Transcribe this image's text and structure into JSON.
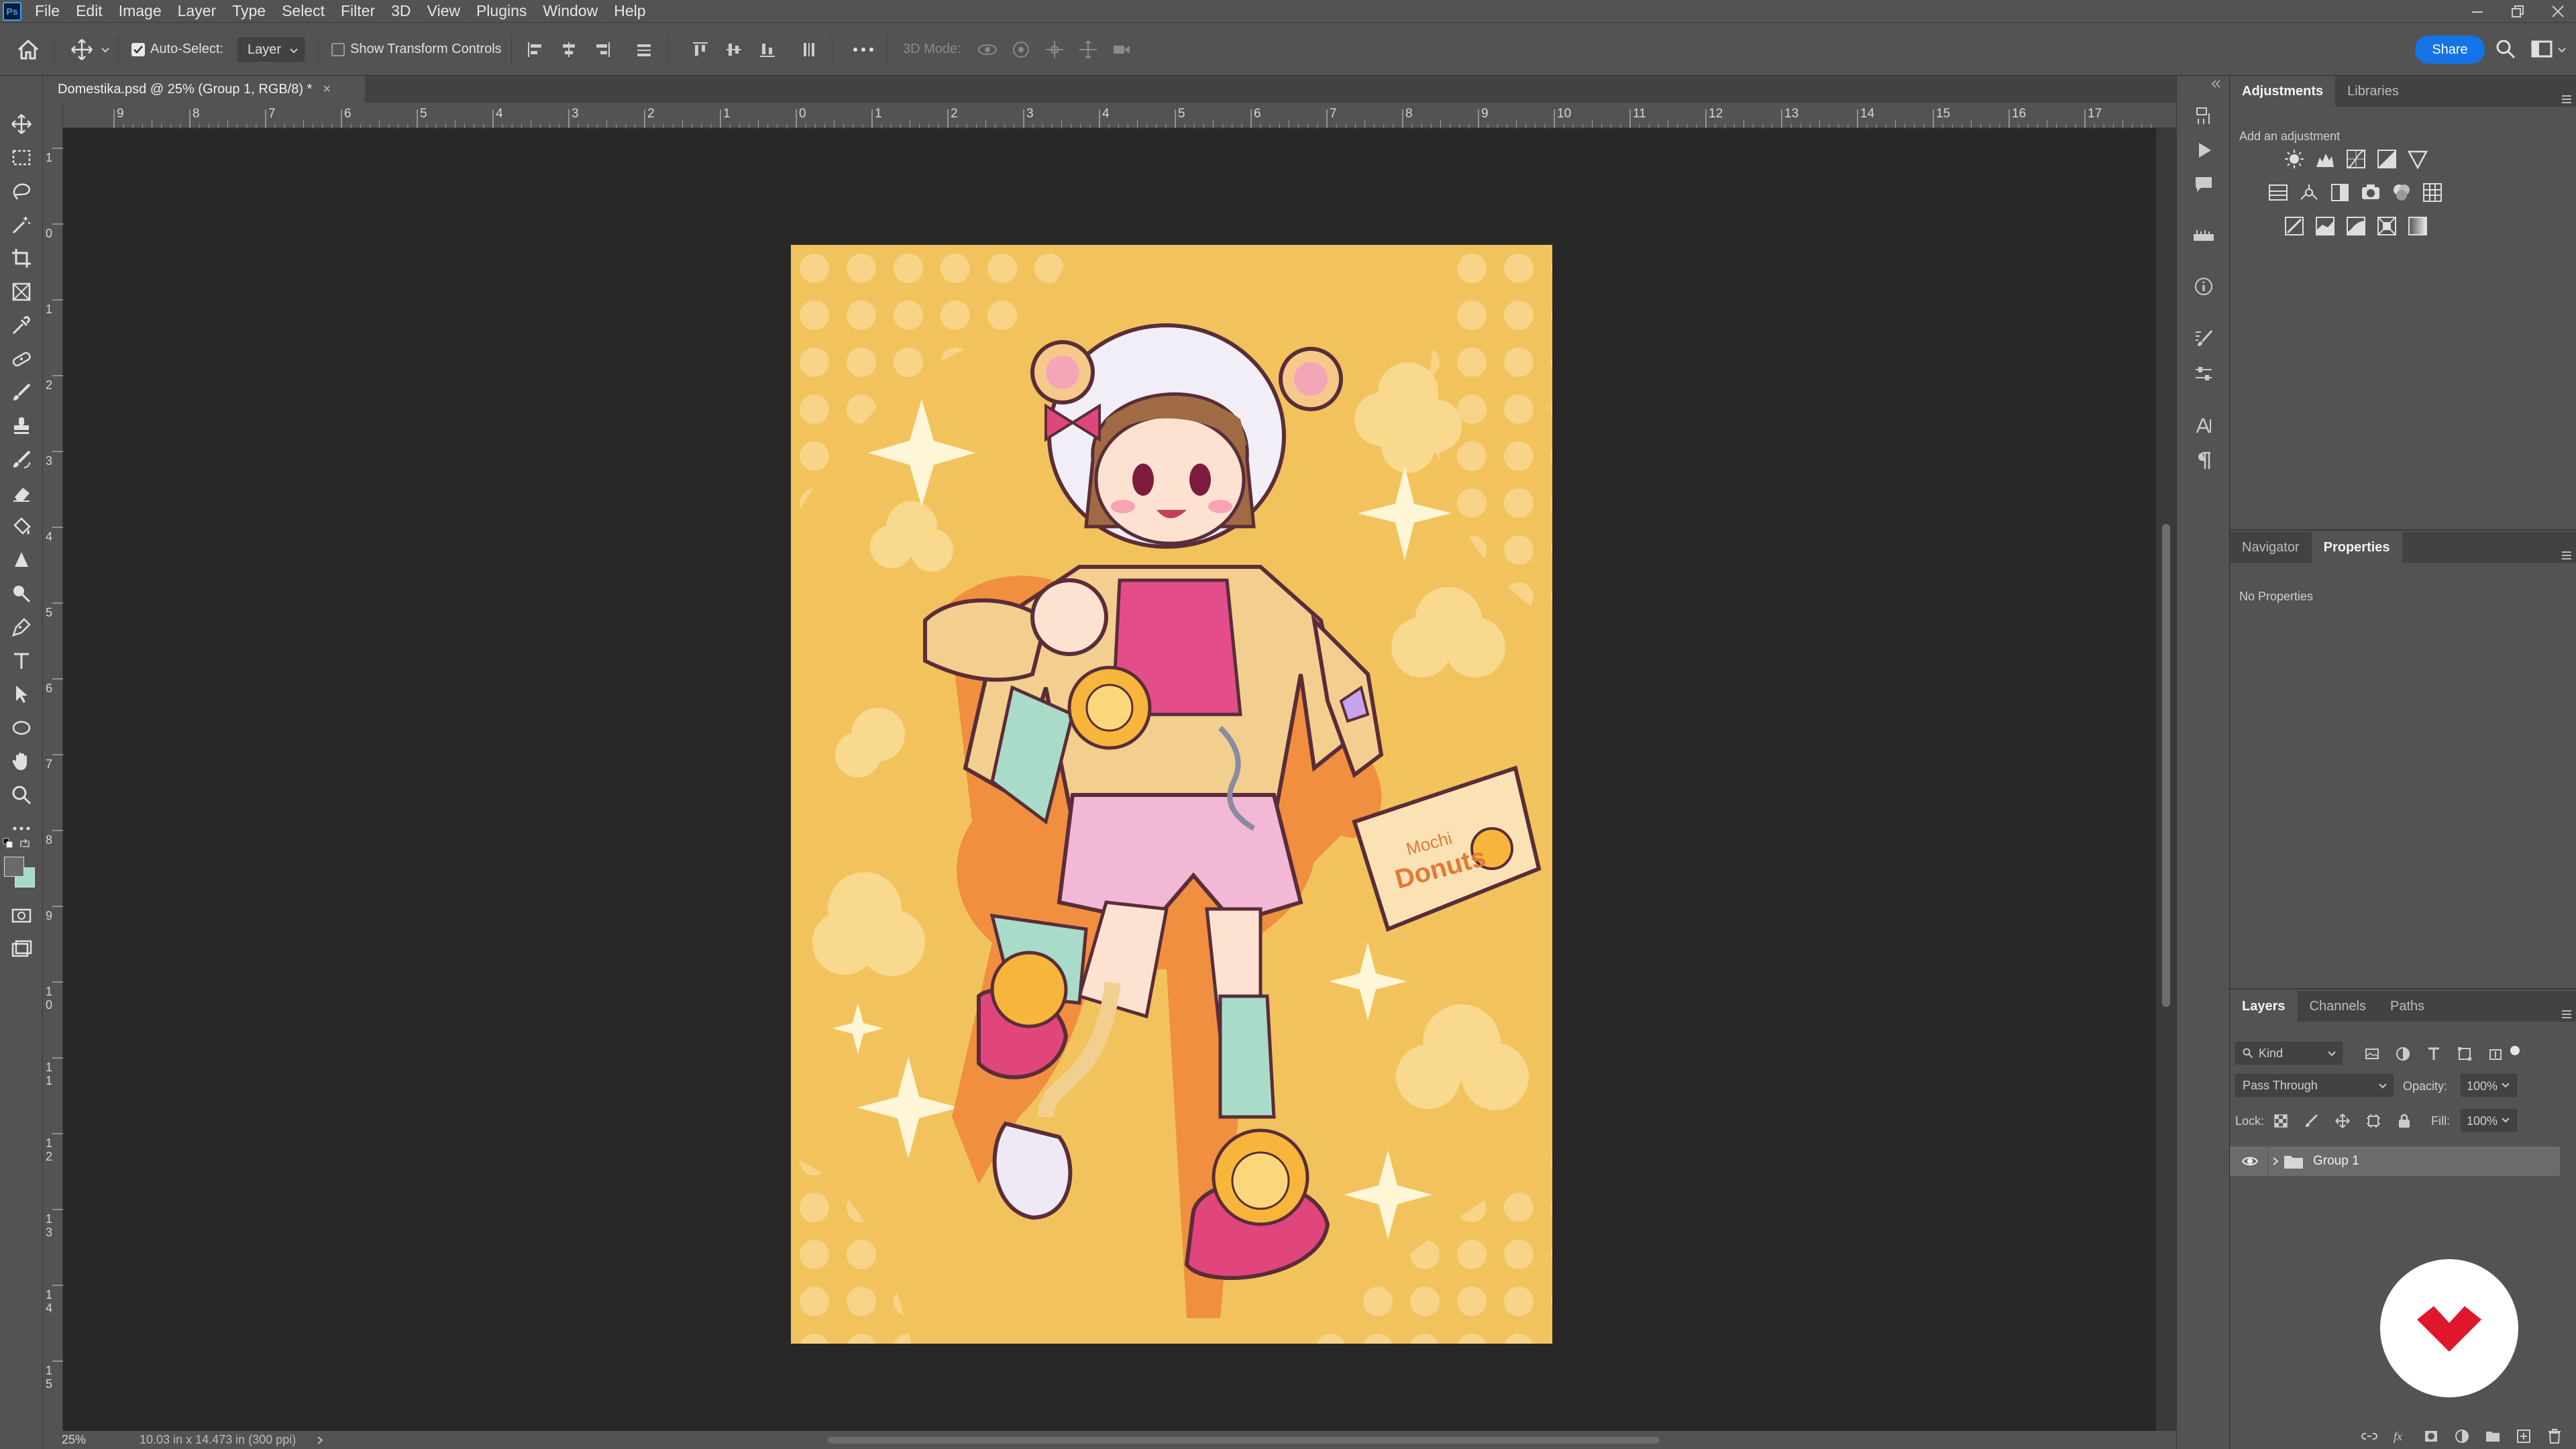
{
  "menu": {
    "app_icon": "Ps",
    "items": [
      "File",
      "Edit",
      "Image",
      "Layer",
      "Type",
      "Select",
      "Filter",
      "3D",
      "View",
      "Plugins",
      "Window",
      "Help"
    ]
  },
  "options_bar": {
    "auto_select_label": "Auto-Select:",
    "auto_select_checked": true,
    "auto_select_target": "Layer",
    "show_transform_label": "Show Transform Controls",
    "show_transform_checked": false,
    "mode_3d_label": "3D Mode:",
    "share_label": "Share"
  },
  "document": {
    "tab_title": "Domestika.psd @ 25% (Group 1, RGB/8) *",
    "close_glyph": "×",
    "zoom": "25%",
    "doc_info": "10.03 in x 14.473 in (300 ppi)"
  },
  "rulers": {
    "horizontal": [
      "9",
      "8",
      "7",
      "6",
      "5",
      "4",
      "3",
      "2",
      "1",
      "0",
      "1",
      "2",
      "3",
      "4",
      "5",
      "6",
      "7",
      "8",
      "9",
      "10",
      "11",
      "12",
      "13",
      "14",
      "15",
      "16",
      "17"
    ],
    "vertical": [
      "1",
      "0",
      "1",
      "2",
      "3",
      "4",
      "5",
      "6",
      "7",
      "8",
      "9",
      "1\n0",
      "1\n1",
      "1\n2",
      "1\n3",
      "1\n4",
      "1\n5"
    ]
  },
  "artwork": {
    "box_text_1": "Mochi",
    "box_text_2": "Donuts",
    "bg_color": "#f2c35d",
    "accent_pink": "#e0457b",
    "accent_mint": "#a8dcc8"
  },
  "adjustments_panel": {
    "tabs": [
      "Adjustments",
      "Libraries"
    ],
    "active_tab": "Adjustments",
    "add_label": "Add an adjustment",
    "icons_row1": [
      "brightness-icon",
      "levels-icon",
      "curves-icon",
      "exposure-icon",
      "vibrance-icon"
    ],
    "icons_row2": [
      "hue-saturation-icon",
      "color-balance-icon",
      "black-white-icon",
      "photo-filter-icon",
      "channel-mixer-icon",
      "color-lookup-icon"
    ],
    "icons_row3": [
      "invert-icon",
      "posterize-icon",
      "threshold-icon",
      "selective-color-icon",
      "gradient-map-icon"
    ]
  },
  "properties_panel": {
    "tabs": [
      "Navigator",
      "Properties"
    ],
    "active_tab": "Properties",
    "empty_text": "No Properties"
  },
  "layers_panel": {
    "tabs": [
      "Layers",
      "Channels",
      "Paths"
    ],
    "active_tab": "Layers",
    "filter_label": "Kind",
    "blend_mode": "Pass Through",
    "opacity_label": "Opacity:",
    "opacity_value": "100%",
    "lock_label": "Lock:",
    "fill_label": "Fill:",
    "fill_value": "100%",
    "layers": [
      {
        "name": "Group 1",
        "type": "group",
        "visible": true,
        "selected": true
      }
    ]
  },
  "colors": {
    "accent": "#1473e6",
    "ui_bg": "#535353",
    "canvas_bg": "#282828",
    "fg_swatch": "#6a6a6a",
    "bg_swatch": "#a6dbc8",
    "domestika_red": "#e0162b"
  }
}
